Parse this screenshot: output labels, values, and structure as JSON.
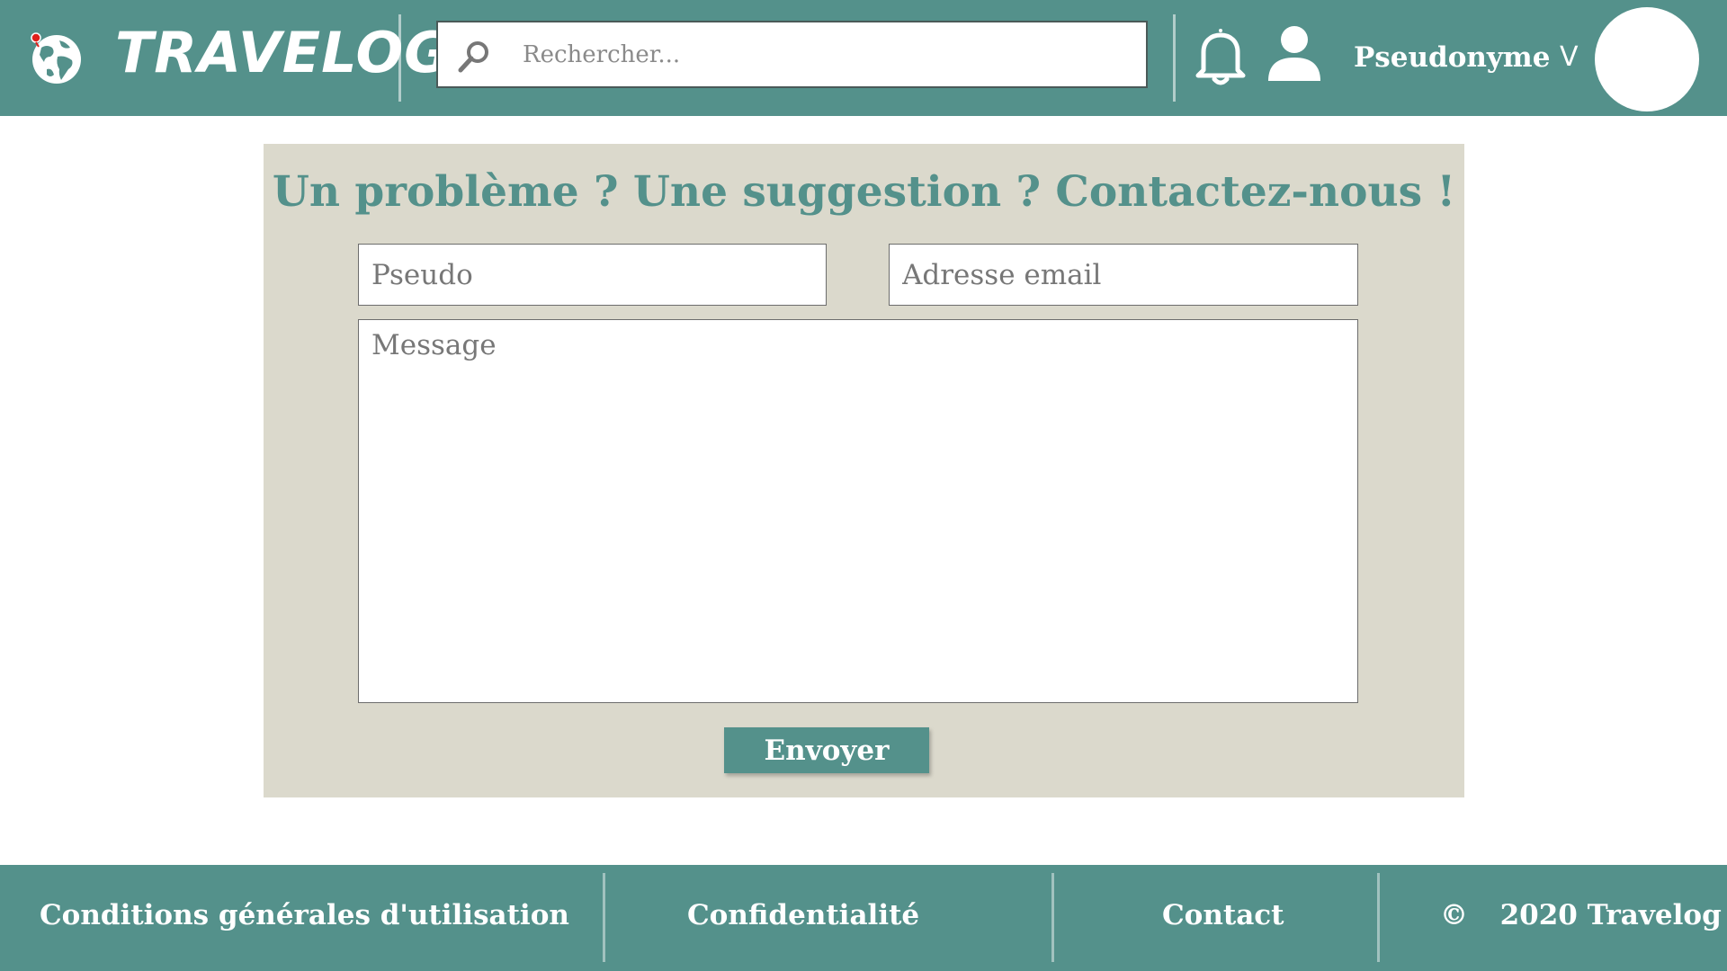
{
  "header": {
    "logo_text": "TRAVELOG",
    "search_placeholder": "Rechercher...",
    "username": "Pseudonyme",
    "chevron": "V",
    "icons": [
      "globe-icon",
      "search-icon",
      "bell-icon",
      "user-icon"
    ]
  },
  "contact": {
    "title": "Un problème ? Une suggestion ? Contactez-nous !",
    "pseudo_placeholder": "Pseudo",
    "email_placeholder": "Adresse email",
    "message_placeholder": "Message",
    "send_label": "Envoyer"
  },
  "footer": {
    "links": [
      "Conditions générales d'utilisation",
      "Confidentialité",
      "Contact"
    ],
    "copyright_symbol": "©",
    "copyright_text": "2020 Travelog"
  },
  "colors": {
    "primary": "#54918b",
    "panel_background": "#dbd9cc",
    "logo_pin": "#e0201b"
  }
}
